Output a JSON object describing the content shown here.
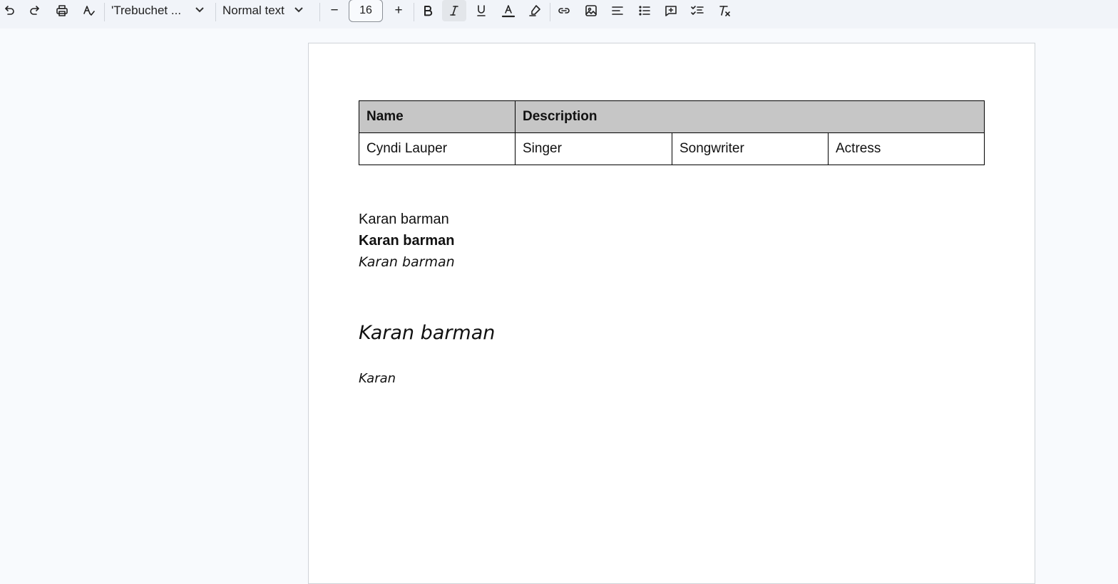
{
  "toolbar": {
    "font_family": "'Trebuchet ...",
    "paragraph_style": "Normal text",
    "font_size": "16",
    "minus_glyph": "−",
    "plus_glyph": "+"
  },
  "document": {
    "table": {
      "header": [
        "Name",
        "Description"
      ],
      "row": [
        "Cyndi Lauper",
        "Singer",
        "Songwriter",
        "Actress"
      ]
    },
    "lines": [
      "Karan barman",
      "Karan barman",
      "Karan barman",
      "Karan barman",
      "Karan"
    ]
  }
}
